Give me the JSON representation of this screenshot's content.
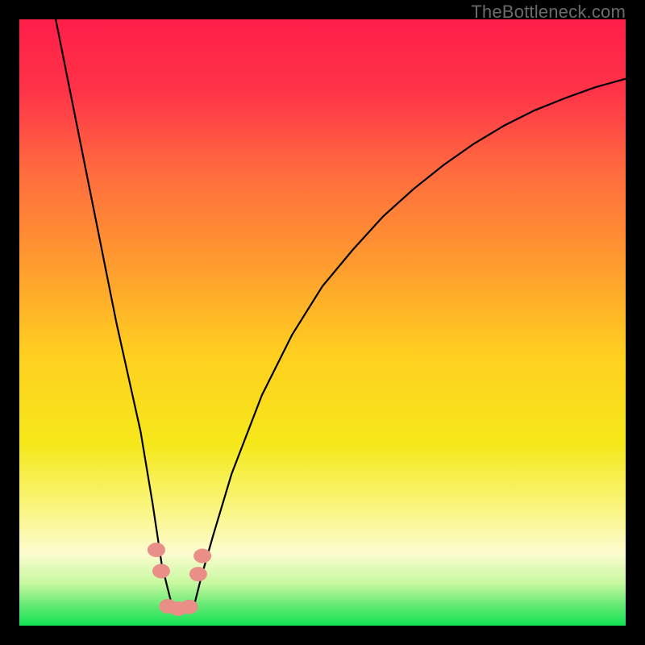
{
  "watermark": "TheBottleneck.com",
  "chart_data": {
    "type": "line",
    "title": "",
    "xlabel": "",
    "ylabel": "",
    "xlim": [
      0,
      100
    ],
    "ylim": [
      0,
      100
    ],
    "grid": false,
    "legend": false,
    "background_gradient": {
      "stops": [
        {
          "offset": 0.0,
          "color": "#ff1e49"
        },
        {
          "offset": 0.12,
          "color": "#ff3448"
        },
        {
          "offset": 0.25,
          "color": "#ff6b3f"
        },
        {
          "offset": 0.4,
          "color": "#ff9a2f"
        },
        {
          "offset": 0.55,
          "color": "#ffcf20"
        },
        {
          "offset": 0.7,
          "color": "#f5e81a"
        },
        {
          "offset": 0.8,
          "color": "#f9f57a"
        },
        {
          "offset": 0.88,
          "color": "#fdfccf"
        },
        {
          "offset": 0.93,
          "color": "#c8f8a0"
        },
        {
          "offset": 0.97,
          "color": "#5be86f"
        },
        {
          "offset": 1.0,
          "color": "#12e354"
        }
      ]
    },
    "series": [
      {
        "name": "bottleneck-curve",
        "color": "#000000",
        "x": [
          6,
          8,
          10,
          12,
          14,
          16,
          18,
          20,
          22,
          23.5,
          25,
          27,
          29,
          30,
          32,
          35,
          40,
          45,
          50,
          55,
          60,
          65,
          70,
          75,
          80,
          85,
          90,
          95,
          100
        ],
        "values": [
          100,
          90,
          80,
          70,
          60,
          50,
          41,
          32,
          20,
          10,
          4,
          3,
          4,
          8,
          15,
          25,
          38,
          48,
          56,
          62,
          67.5,
          72,
          76,
          79.5,
          82.5,
          85,
          87,
          88.8,
          90.2
        ]
      }
    ],
    "markers": [
      {
        "name": "marker-left-upper",
        "x": 22.6,
        "y": 12.5,
        "color": "#e98f87"
      },
      {
        "name": "marker-left-lower",
        "x": 23.4,
        "y": 9.0,
        "color": "#e98f87"
      },
      {
        "name": "marker-right-upper",
        "x": 30.2,
        "y": 11.5,
        "color": "#e98f87"
      },
      {
        "name": "marker-right-lower",
        "x": 29.5,
        "y": 8.5,
        "color": "#e98f87"
      },
      {
        "name": "marker-bottom-1",
        "x": 24.5,
        "y": 3.2,
        "color": "#e98f87"
      },
      {
        "name": "marker-bottom-2",
        "x": 26.2,
        "y": 2.8,
        "color": "#e98f87"
      },
      {
        "name": "marker-bottom-3",
        "x": 28.0,
        "y": 3.1,
        "color": "#e98f87"
      }
    ]
  }
}
